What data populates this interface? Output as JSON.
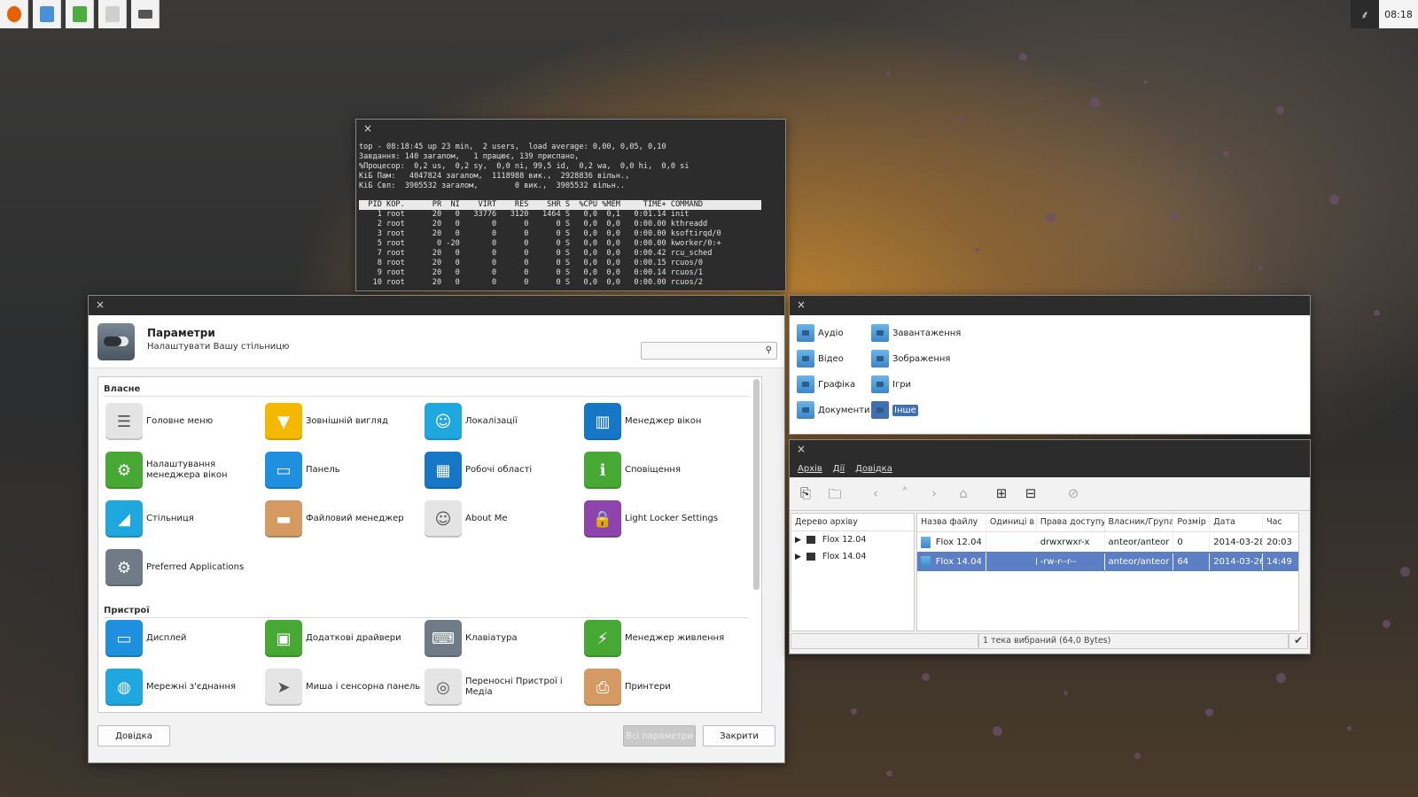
{
  "top_panel": {
    "launchers": [
      "firefox-icon",
      "file-manager-icon",
      "text-editor-icon",
      "archive-icon",
      "terminal-icon"
    ],
    "tray_icon": "leaf-icon",
    "clock": "08:18"
  },
  "terminal": {
    "close": "×",
    "lines": [
      "top - 08:18:45 up 23 min,  2 users,  load average: 0,00, 0,05, 0,10",
      "Завдання: 140 загалом,   1 працює, 139 приспано,",
      "%Процесор:  0,2 us,  0,2 sy,  0,0 ni, 99,5 id,  0,2 wa,  0,0 hi,  0,0 si",
      "КіБ Пам:   4047824 загалом,  1118988 вик.,  2928836 вільн.,",
      "КіБ Свп:  3905532 загалом,        0 вик.,  3905532 вільн..",
      ""
    ],
    "header": "  PID КОР.      PR  NI    VIRT    RES    SHR S  %CPU %MEM     TIME+ COMMAND",
    "rows": [
      "    1 root      20   0   33776   3120   1464 S   0,0  0,1   0:01.14 init",
      "    2 root      20   0       0      0      0 S   0,0  0,0   0:00.00 kthreadd",
      "    3 root      20   0       0      0      0 S   0,0  0,0   0:00.00 ksoftirqd/0",
      "    5 root       0 -20       0      0      0 S   0,0  0,0   0:00.00 kworker/0:+",
      "    7 root      20   0       0      0      0 S   0,0  0,0   0:00.42 rcu_sched",
      "    8 root      20   0       0      0      0 S   0,0  0,0   0:00.15 rcuos/0",
      "    9 root      20   0       0      0      0 S   0,0  0,0   0:00.14 rcuos/1",
      "   10 root      20   0       0      0      0 S   0,0  0,0   0:00.00 rcuos/2"
    ]
  },
  "settings": {
    "close": "×",
    "title": "Параметри",
    "subtitle": "Налаштувати Вашу стільницю",
    "search_placeholder": "",
    "section_own": "Власне",
    "section_devices": "Пристрої",
    "own_items": [
      {
        "label": "Головне меню",
        "icon": "menu-list-icon",
        "color": "#e4e4e4"
      },
      {
        "label": "Зовнішній вигляд",
        "icon": "tshirt-icon",
        "color": "#f5b800"
      },
      {
        "label": "Локалізації",
        "icon": "id-card-icon",
        "color": "#1fa7df"
      },
      {
        "label": "Менеджер вікон",
        "icon": "window-layout-icon",
        "color": "#1577c6"
      },
      {
        "label": "Налаштування менеджера вікон",
        "icon": "gear-icon",
        "color": "#47a833"
      },
      {
        "label": "Панель",
        "icon": "panel-icon",
        "color": "#1f8fe0"
      },
      {
        "label": "Робочі області",
        "icon": "workspaces-icon",
        "color": "#1577c6"
      },
      {
        "label": "Сповіщення",
        "icon": "info-bubble-icon",
        "color": "#47a833"
      },
      {
        "label": "Стільниця",
        "icon": "desktop-icon",
        "color": "#1fa7df"
      },
      {
        "label": "Файловий менеджер",
        "icon": "folder-icon",
        "color": "#d59a62"
      },
      {
        "label": "About Me",
        "icon": "contact-card-icon",
        "color": "#e4e4e4"
      },
      {
        "label": "Light Locker Settings",
        "icon": "lock-icon",
        "color": "#8e44ad"
      },
      {
        "label": "Preferred Applications",
        "icon": "gear-icon",
        "color": "#6f7c88"
      }
    ],
    "device_items": [
      {
        "label": "Дисплей",
        "icon": "monitor-icon",
        "color": "#1f8fe0"
      },
      {
        "label": "Додаткові драйвери",
        "icon": "chip-icon",
        "color": "#47a833"
      },
      {
        "label": "Клавіатура",
        "icon": "keyboard-icon",
        "color": "#6f7c88"
      },
      {
        "label": "Менеджер живлення",
        "icon": "lightning-icon",
        "color": "#47a833"
      },
      {
        "label": "Мережні з'єднання",
        "icon": "globe-icon",
        "color": "#1fa7df"
      },
      {
        "label": "Миша і сенсорна панель",
        "icon": "cursor-icon",
        "color": "#e4e4e4"
      },
      {
        "label": "Переносні Пристрої і Медіа",
        "icon": "media-icon",
        "color": "#e4e4e4"
      },
      {
        "label": "Принтери",
        "icon": "printer-icon",
        "color": "#d59a62"
      }
    ],
    "help_button": "Довідка",
    "all_button": "Всі параметри",
    "close_button": "Закрити"
  },
  "places": {
    "close": "×",
    "items": [
      {
        "label": "Аудіо"
      },
      {
        "label": "Завантаження"
      },
      {
        "label": "Відео"
      },
      {
        "label": "Зображення"
      },
      {
        "label": "Графіка"
      },
      {
        "label": "Ігри"
      },
      {
        "label": "Документи"
      },
      {
        "label": "Інше",
        "selected": true
      }
    ]
  },
  "archive": {
    "close": "×",
    "menu": [
      "Архів",
      "Дії",
      "Довідка"
    ],
    "toolbar": [
      "new-archive-icon",
      "open-folder-icon",
      "back-icon",
      "up-icon",
      "forward-icon",
      "home-icon",
      "add-files-icon",
      "extract-icon",
      "stop-icon"
    ],
    "tree_header": "Дерево архіву",
    "tree": [
      "Flox 12.04",
      "Flox 14.04"
    ],
    "columns": [
      "Назва файлу",
      "Одиниці в",
      "Права доступу",
      "Власник/Група",
      "Розмір",
      "Дата",
      "Час"
    ],
    "rows": [
      {
        "name": "Flox 12.04",
        "units": "",
        "perm": "drwxrwxr-x",
        "owner": "anteor/anteor",
        "size": "0",
        "date": "2014-03-28",
        "time": "20:03"
      },
      {
        "name": "Flox 14.04",
        "units": "",
        "perm": "-rw-r--r--",
        "owner": "anteor/anteor",
        "size": "64",
        "date": "2014-03-26",
        "time": "14:49"
      }
    ],
    "status": "1 тека вибраний (64,0 Bytes)"
  }
}
